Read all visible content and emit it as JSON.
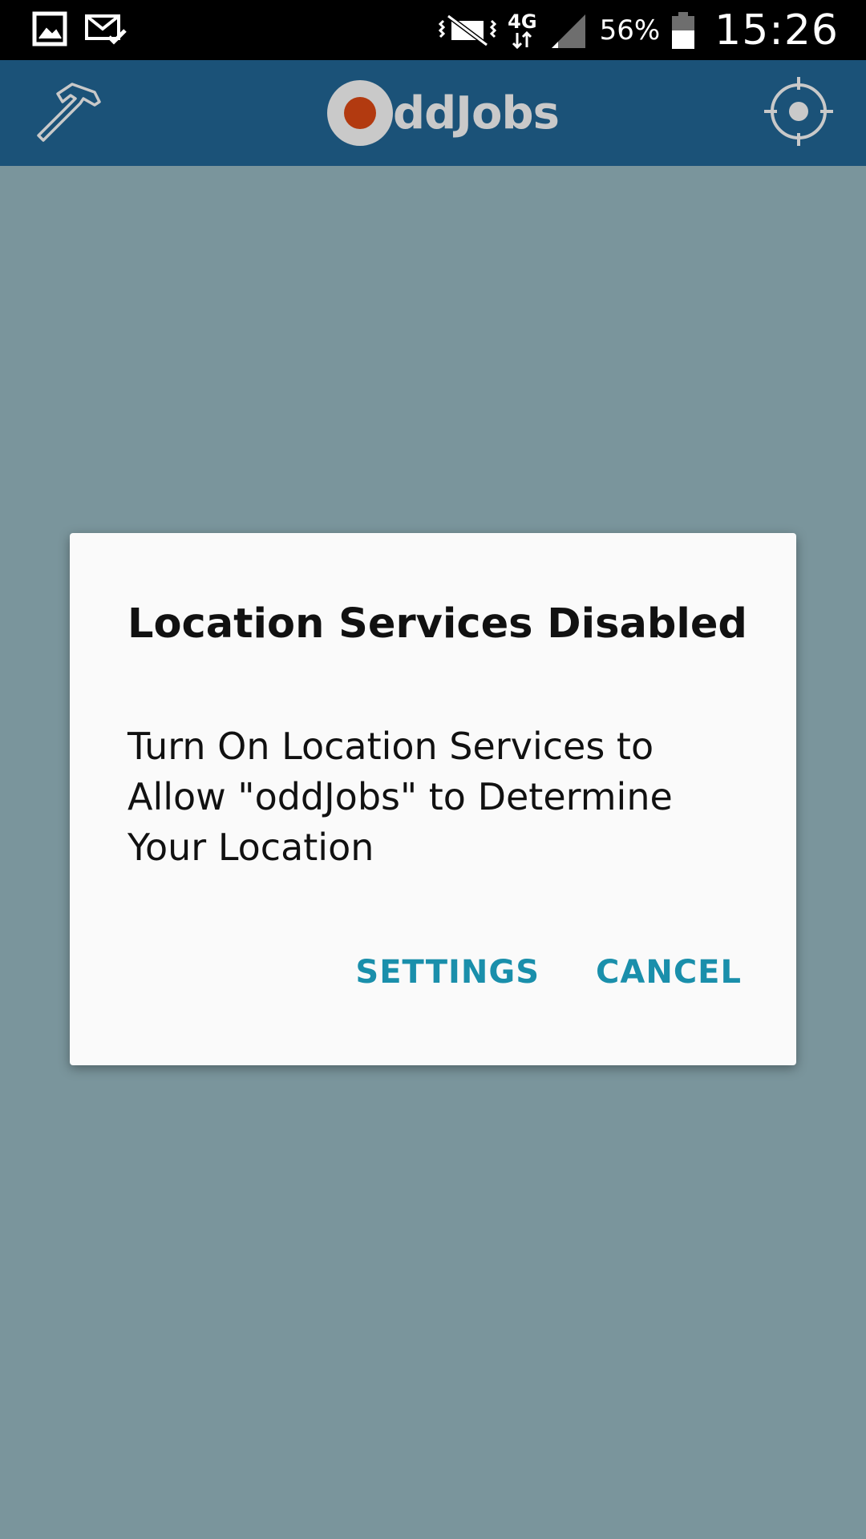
{
  "status_bar": {
    "left_icons": [
      "gallery-icon",
      "mail-check-icon"
    ],
    "right_icons": [
      "vibrate-mute-icon",
      "network-4g-icon",
      "signal-icon",
      "battery-icon"
    ],
    "network_type": "4G",
    "battery_percent": "56%",
    "time": "15:26"
  },
  "app_bar": {
    "left_icon": "hammer-icon",
    "logo_text": "ddJobs",
    "right_icon": "crosshair-location-icon",
    "background_color": "#1b5278"
  },
  "dialog": {
    "title": "Location Services Disabled",
    "message": "Turn On Location Services to Allow \"oddJobs\" to Determine Your Location",
    "settings_label": "SETTINGS",
    "cancel_label": "CANCEL",
    "button_color": "#1a8fab"
  },
  "colors": {
    "background_dim": "#7a959c",
    "logo_accent": "#b23a10"
  }
}
